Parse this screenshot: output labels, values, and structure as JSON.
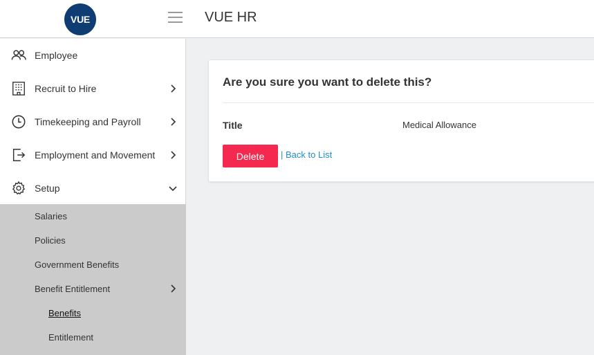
{
  "header": {
    "logo_text": "VUE",
    "title": "VUE HR",
    "brand_color": "#0f3d73"
  },
  "sidebar": {
    "items": [
      {
        "label": "Employee",
        "icon": "people-icon"
      },
      {
        "label": "Recruit to Hire",
        "icon": "building-icon"
      },
      {
        "label": "Timekeeping and Payroll",
        "icon": "clock-icon"
      },
      {
        "label": "Employment and Movement",
        "icon": "exit-icon"
      },
      {
        "label": "Setup",
        "icon": "gear-icon",
        "expanded": true
      }
    ],
    "setup_submenu": [
      {
        "label": "Salaries"
      },
      {
        "label": "Policies"
      },
      {
        "label": "Government Benefits"
      },
      {
        "label": "Benefit Entitlement"
      }
    ],
    "benefit_submenu": [
      {
        "label": "Benefits",
        "active": true
      },
      {
        "label": "Entitlement"
      }
    ]
  },
  "card": {
    "title": "Are you sure you want to delete this?",
    "field_label": "Title",
    "field_value": "Medical Allowance",
    "delete_label": "Delete",
    "separator": "|",
    "back_label": "Back to List",
    "delete_color": "#f5294f",
    "link_color": "#1f8fc9"
  }
}
